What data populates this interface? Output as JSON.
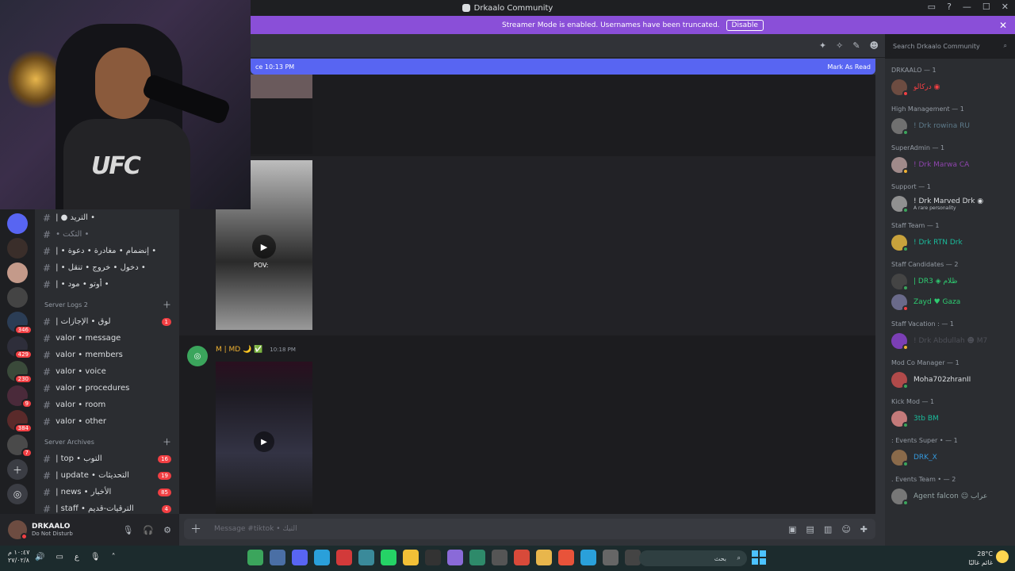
{
  "window": {
    "title": "Drkaalo Community",
    "controls": [
      "▭",
      "?",
      "—",
      "☐",
      "✕"
    ]
  },
  "banner": {
    "text": "Streamer Mode is enabled. Usernames have been truncated.",
    "button": "Disable"
  },
  "header": {
    "search_placeholder": "Search Drkaalo Community"
  },
  "newbar": {
    "since": "ce 10:13 PM",
    "mark_read": "Mark As Read"
  },
  "servers": [
    {
      "badge": ""
    },
    {
      "badge": ""
    },
    {
      "badge": ""
    },
    {
      "badge": ""
    },
    {
      "badge": "346"
    },
    {
      "badge": "429"
    },
    {
      "badge": "230"
    },
    {
      "badge": "9"
    },
    {
      "badge": "384"
    },
    {
      "badge": "7"
    }
  ],
  "channels": {
    "top": [
      {
        "label": "| ● التريد •",
        "dim": false
      },
      {
        "label": "• التكت •",
        "dim": true
      },
      {
        "label": "| • إنضمام • مغادرة • دعوة •",
        "dim": false
      },
      {
        "label": "| • دخول • خروج • تنقل •",
        "dim": false
      },
      {
        "label": "| • أوتو • مود •",
        "dim": false
      }
    ],
    "logs_category": "Server Logs 2",
    "logs": [
      {
        "label": "| لوق • الإجازات",
        "badge": "1"
      },
      {
        "label": "valor • message",
        "badge": ""
      },
      {
        "label": "valor • members",
        "badge": ""
      },
      {
        "label": "valor • voice",
        "badge": ""
      },
      {
        "label": "valor • procedures",
        "badge": ""
      },
      {
        "label": "valor • room",
        "badge": ""
      },
      {
        "label": "valor • other",
        "badge": ""
      }
    ],
    "archives_category": "Server Archives",
    "archives": [
      {
        "label": "| top • التوب",
        "badge": "16"
      },
      {
        "label": "| update • التحديثات",
        "badge": "19"
      },
      {
        "label": "| news • الأخبار",
        "badge": "85"
      },
      {
        "label": "| staff • الترقيات-قديم",
        "badge": "4"
      }
    ]
  },
  "user": {
    "name": "DRKAALO",
    "status": "Do Not Disturb"
  },
  "messages": {
    "media2_label": "POV:",
    "author": "M | MD 🌙 ✅",
    "time": "10:18 PM"
  },
  "composer": {
    "placeholder": "Message #tiktok • التيك"
  },
  "members": [
    {
      "role": "DRKAALO — 1",
      "items": [
        {
          "name": "دركالو ◉",
          "sub": "",
          "color": "#f23f43",
          "status": "#f23f43",
          "avatar": "#6d4c41"
        }
      ]
    },
    {
      "role": "High Management — 1",
      "items": [
        {
          "name": "! Drk rowina RU",
          "sub": "",
          "color": "#5d7a8a",
          "status": "#3ba55c",
          "avatar": "#707070"
        }
      ]
    },
    {
      "role": "SuperAdmin — 1",
      "items": [
        {
          "name": "! Drk Marwa CA",
          "sub": "",
          "color": "#8e44ad",
          "status": "#f0b232",
          "avatar": "#a08a8a"
        }
      ]
    },
    {
      "role": "Support — 1",
      "items": [
        {
          "name": "! Drk Marved Drk ◉",
          "sub": "A rare personality",
          "color": "#dbdee1",
          "status": "#3ba55c",
          "avatar": "#909090"
        }
      ]
    },
    {
      "role": "Staff Team — 1",
      "items": [
        {
          "name": "! Drk RTN Drk",
          "sub": "",
          "color": "#1abc9c",
          "status": "#3ba55c",
          "avatar": "#c8a23c"
        }
      ]
    },
    {
      "role": "Staff Candidates — 2",
      "items": [
        {
          "name": "| DR3 ◈ ظلام",
          "sub": "",
          "color": "#2ecc71",
          "status": "#3ba55c",
          "avatar": "#444"
        },
        {
          "name": "Zayd ♥ Gaza",
          "sub": "",
          "color": "#2ecc71",
          "status": "#f23f43",
          "avatar": "#6a6a8a"
        }
      ]
    },
    {
      "role": "Staff Vacation : — 1",
      "items": [
        {
          "name": "! Drk Abdullah ☻ M7",
          "sub": "",
          "color": "#4e5058",
          "status": "#f0b232",
          "avatar": "#7b3fb5"
        }
      ]
    },
    {
      "role": "Mod Co Manager — 1",
      "items": [
        {
          "name": "Moha702zhranII",
          "sub": "",
          "color": "#dbdee1",
          "status": "#3ba55c",
          "avatar": "#b04a4a"
        }
      ]
    },
    {
      "role": "Kick Mod — 1",
      "items": [
        {
          "name": "3tb BM",
          "sub": "",
          "color": "#1abc9c",
          "status": "#3ba55c",
          "avatar": "#c47a7a"
        }
      ]
    },
    {
      "role": ": Events Super • — 1",
      "items": [
        {
          "name": "DRK_X",
          "sub": "",
          "color": "#3498db",
          "status": "#3ba55c",
          "avatar": "#8a6a4a"
        }
      ]
    },
    {
      "role": ". Events Team • — 2",
      "items": [
        {
          "name": "Agent falcon ☺ عراب",
          "sub": "",
          "color": "#95a5a6",
          "status": "#3ba55c",
          "avatar": "#777"
        }
      ]
    }
  ],
  "taskbar": {
    "time": "١٠:٤٧ م",
    "date": "٢٧/٠٢/٨",
    "lang": "ع",
    "search": "بحث",
    "weather_temp": "28°C",
    "weather_text": "غائم غالبًا"
  }
}
